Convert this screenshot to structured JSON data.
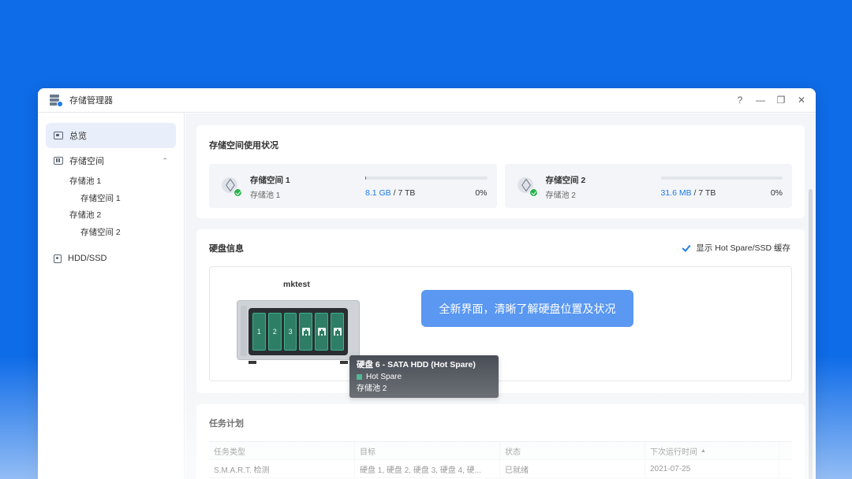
{
  "window": {
    "title": "存储管理器",
    "controls": {
      "help": "?",
      "minimize": "—",
      "restore": "❐",
      "close": "✕"
    }
  },
  "sidebar": {
    "items": [
      {
        "label": "总览",
        "icon": "overview-icon",
        "active": true
      },
      {
        "label": "存储空间",
        "icon": "storage-icon",
        "expanded": true
      },
      {
        "label": "HDD/SSD",
        "icon": "hdd-icon"
      }
    ],
    "sub": [
      {
        "label": "存储池 1",
        "level": 1
      },
      {
        "label": "存储空间 1",
        "level": 2
      },
      {
        "label": "存储池 2",
        "level": 1
      },
      {
        "label": "存储空间 2",
        "level": 2
      }
    ],
    "chevron": "⌃"
  },
  "usage": {
    "title": "存储空间使用状况",
    "volumes": [
      {
        "name": "存储空间 1",
        "pool": "存储池 1",
        "used": "8.1 GB",
        "total": " / 7 TB",
        "percent": "0%",
        "fill": 0.001,
        "status_color": "#26b14a"
      },
      {
        "name": "存储空间 2",
        "pool": "存储池 2",
        "used": "31.6 MB",
        "total": " / 7 TB",
        "percent": "0%",
        "fill": 0.0,
        "status_color": "#26b14a"
      }
    ]
  },
  "disk_info": {
    "title": "硬盘信息",
    "hotspare_label": "显示 Hot Spare/SSD 缓存",
    "hotspare_checked": true,
    "nas_name": "mktest",
    "drives": [
      "1",
      "2",
      "3",
      "",
      "",
      ""
    ],
    "banner": "全新界面，清晰了解硬盘位置及状况",
    "tooltip": {
      "title": "硬盘 6 - SATA HDD (Hot Spare)",
      "status": "Hot Spare",
      "pool": "存储池 2"
    }
  },
  "tasks": {
    "title": "任务计划",
    "columns": [
      "任务类型",
      "目标",
      "状态",
      "下次运行时间",
      ""
    ],
    "sort_indicator": "▲",
    "rows": [
      [
        "S.M.A.R.T. 检测",
        "硬盘 1, 硬盘 2, 硬盘 3, 硬盘 4, 硬...",
        "已就绪",
        "2021-07-25",
        ""
      ]
    ]
  },
  "colors": {
    "background": "#0f6ce8",
    "accent": "#1d7be8",
    "healthy": "#26b14a",
    "drive": "#2e7d65",
    "banner": "#5a98f1"
  }
}
